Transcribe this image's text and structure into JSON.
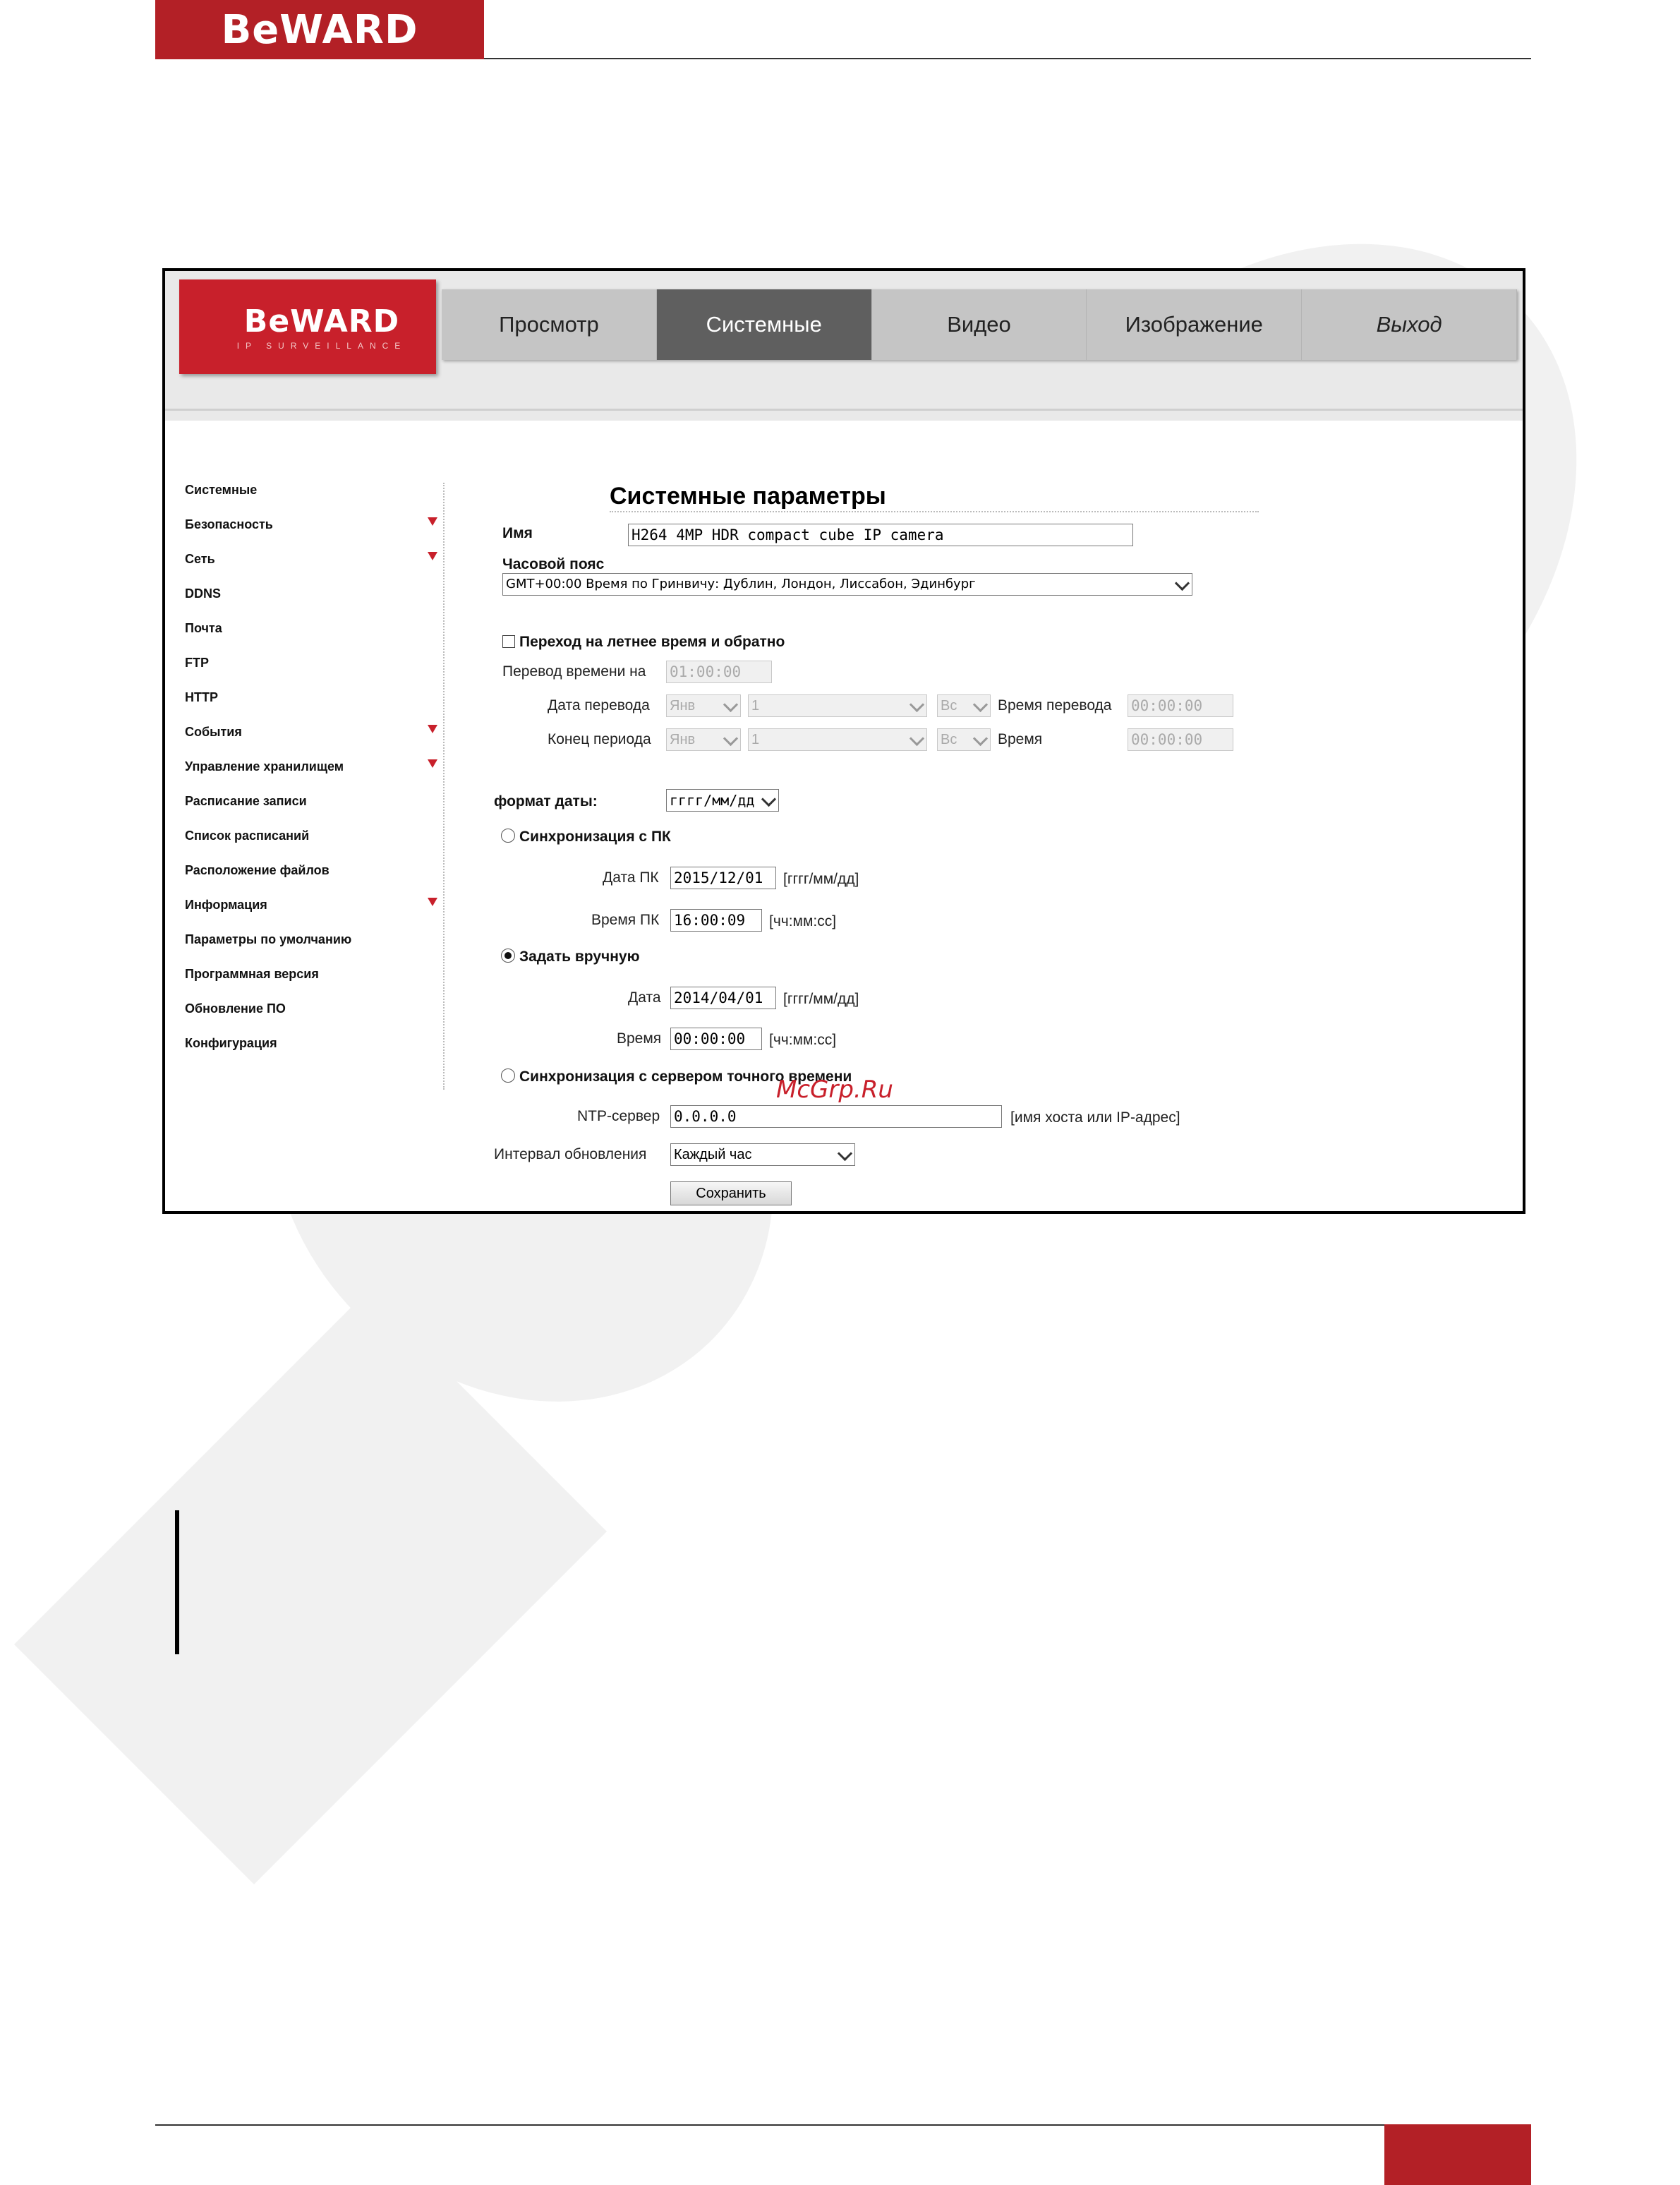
{
  "document": {
    "logo_text": "BeWARD"
  },
  "app": {
    "logo_text": "BeWARD",
    "logo_sub": "IP SURVEILLANCE",
    "nav": [
      {
        "label": "Просмотр",
        "active": false
      },
      {
        "label": "Системные",
        "active": true
      },
      {
        "label": "Видео",
        "active": false
      },
      {
        "label": "Изображение",
        "active": false
      },
      {
        "label": "Выход",
        "active": false
      }
    ]
  },
  "sidebar": {
    "items": [
      {
        "label": "Системные",
        "expandable": false
      },
      {
        "label": "Безопасность",
        "expandable": true
      },
      {
        "label": "Сеть",
        "expandable": true
      },
      {
        "label": "DDNS",
        "expandable": false
      },
      {
        "label": "Почта",
        "expandable": false
      },
      {
        "label": "FTP",
        "expandable": false
      },
      {
        "label": "HTTP",
        "expandable": false
      },
      {
        "label": "События",
        "expandable": true
      },
      {
        "label": "Управление хранилищем",
        "expandable": true
      },
      {
        "label": "Расписание записи",
        "expandable": false
      },
      {
        "label": "Список расписаний",
        "expandable": false
      },
      {
        "label": "Расположение файлов",
        "expandable": false
      },
      {
        "label": "Информация",
        "expandable": true
      },
      {
        "label": "Параметры по умолчанию",
        "expandable": false
      },
      {
        "label": "Программная версия",
        "expandable": false
      },
      {
        "label": "Обновление ПО",
        "expandable": false
      },
      {
        "label": "Конфигурация",
        "expandable": false
      }
    ]
  },
  "form": {
    "title": "Системные параметры",
    "name_label": "Имя",
    "name_value": "H264 4MP HDR compact cube IP camera",
    "timezone_label": "Часовой пояс",
    "timezone_value": "GMT+00:00 Время по Гринвичу: Дублин, Лондон, Лиссабон, Эдинбург",
    "dst": {
      "checkbox_label": "Переход на летнее время и обратно",
      "checked": false,
      "shift_label": "Перевод времени на",
      "shift_value": "01:00:00",
      "start_label": "Дата перевода",
      "start_month": "Янв",
      "start_week": "1",
      "start_day": "Вс",
      "start_time_label": "Время перевода",
      "start_time": "00:00:00",
      "end_label": "Конец периода",
      "end_month": "Янв",
      "end_week": "1",
      "end_day": "Вс",
      "end_time_label": "Время",
      "end_time": "00:00:00"
    },
    "date_format_label": "формат даты:",
    "date_format_value": "гггг/мм/дд",
    "sync_pc": {
      "label": "Синхронизация с ПК",
      "selected": false,
      "date_label": "Дата ПК",
      "date_value": "2015/12/01",
      "date_hint": "[гггг/мм/дд]",
      "time_label": "Время ПК",
      "time_value": "16:00:09",
      "time_hint": "[чч:мм:сс]"
    },
    "manual": {
      "label": "Задать вручную",
      "selected": true,
      "date_label": "Дата",
      "date_value": "2014/04/01",
      "date_hint": "[гггг/мм/дд]",
      "time_label": "Время",
      "time_value": "00:00:00",
      "time_hint": "[чч:мм:сс]"
    },
    "ntp": {
      "label": "Синхронизация с сервером точного времени",
      "selected": false,
      "server_label": "NTP-сервер",
      "server_value": "0.0.0.0",
      "server_hint": "[имя хоста или IP-адрес]",
      "interval_label": "Интервал обновления",
      "interval_value": "Каждый час"
    },
    "save_label": "Сохранить"
  },
  "watermark_text": "McGrp.Ru",
  "colors": {
    "brand_red": "#c8202b",
    "nav_active": "#5f5f5f",
    "nav_bg": "#c5c5c5"
  }
}
